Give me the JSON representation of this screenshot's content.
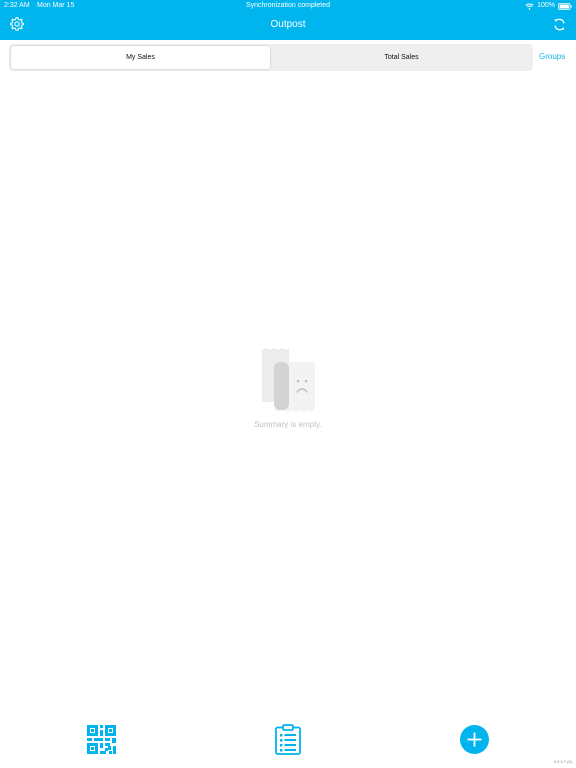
{
  "status_bar": {
    "time": "2:32 AM",
    "date": "Mon Mar 15",
    "sync_status": "Synchronization completed",
    "battery": "100%"
  },
  "nav": {
    "title": "Outpost",
    "left_icon": "gear-icon",
    "right_icon": "sync-icon"
  },
  "segments": {
    "items": [
      "My Sales",
      "Total Sales"
    ],
    "selected": "My Sales"
  },
  "groups_link": "Groups",
  "empty_state": {
    "icon": "empty-receipt-icon",
    "message": "Summary is empty."
  },
  "bottom_bar": {
    "left_icon": "qr-code-icon",
    "center_icon": "clipboard-list-icon",
    "right_icon": "add-icon"
  },
  "version": "4.0.0.7 (0)",
  "colors": {
    "accent": "#00b5ee",
    "link": "#1ab3ea",
    "empty_text": "#c2c2c2",
    "segment_bg": "#efeff0"
  }
}
